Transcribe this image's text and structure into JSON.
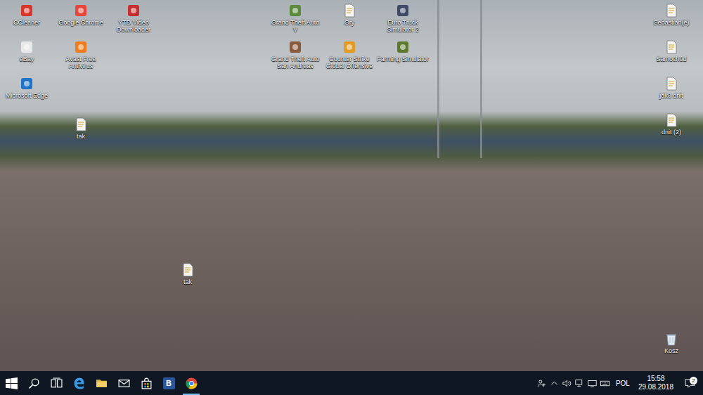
{
  "desktop": {
    "icons": [
      {
        "label": "CCleaner",
        "kind": "app",
        "color": "#d9362b"
      },
      {
        "label": "Google Chrome",
        "kind": "app",
        "color": "#e8453c"
      },
      {
        "label": "YTD Video Downloader",
        "kind": "app",
        "color": "#c62f2f"
      },
      {
        "label": "eBay",
        "kind": "app",
        "color": "#e9e9e9"
      },
      {
        "label": "Avast Free Antivirus",
        "kind": "app",
        "color": "#f07c1b"
      },
      {
        "label": "Microsoft Edge",
        "kind": "app",
        "color": "#1f74c8"
      },
      {
        "label": "tak",
        "kind": "document"
      },
      {
        "label": "Grand Theft Auto V",
        "kind": "app",
        "color": "#5b8b3a"
      },
      {
        "label": "Gry",
        "kind": "document"
      },
      {
        "label": "Euro Truck Simulator 2",
        "kind": "app",
        "color": "#3c4a66"
      },
      {
        "label": "Grand Theft Auto San Andreas",
        "kind": "app",
        "color": "#8a5a3c"
      },
      {
        "label": "Counter Strike Global Offensive",
        "kind": "app",
        "color": "#e39b22"
      },
      {
        "label": "Farming Simulator",
        "kind": "app",
        "color": "#5c7a2e"
      },
      {
        "label": "Sebastian(e)",
        "kind": "document"
      },
      {
        "label": "Samochód",
        "kind": "document"
      },
      {
        "label": "jak8 dnit",
        "kind": "document"
      },
      {
        "label": "dnit (2)",
        "kind": "document"
      },
      {
        "label": "tak",
        "kind": "document"
      },
      {
        "label": "Kosz",
        "kind": "bin"
      }
    ]
  },
  "taskbar": {
    "items": [
      {
        "kind": "start",
        "running": false
      },
      {
        "kind": "search",
        "running": false
      },
      {
        "kind": "taskview",
        "running": false
      },
      {
        "kind": "edge",
        "running": false
      },
      {
        "kind": "explorer",
        "running": false
      },
      {
        "kind": "mail",
        "running": false
      },
      {
        "kind": "store",
        "running": false
      },
      {
        "kind": "letter",
        "glyph": "B",
        "running": false
      },
      {
        "kind": "chrome",
        "running": true
      }
    ],
    "tray": {
      "language": "POL",
      "time": "15:58",
      "date": "29.08.2018",
      "notifications": "2"
    }
  }
}
